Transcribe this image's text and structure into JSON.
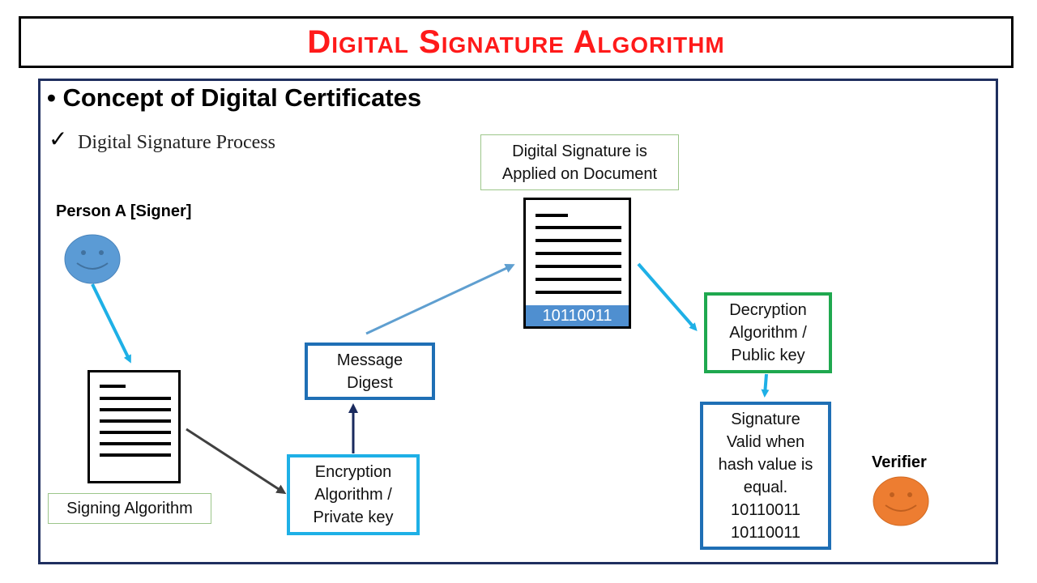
{
  "title": "Digital Signature Algorithm",
  "heading": "Concept of Digital Certificates",
  "bullet_char": "•",
  "check_char": "✓",
  "subheading": "Digital Signature Process",
  "person_a": "Person A [Signer]",
  "verifier": "Verifier",
  "signing_algorithm": "Signing Algorithm",
  "encryption": [
    "Encryption",
    "Algorithm /",
    "Private key"
  ],
  "message_digest": [
    "Message",
    "Digest"
  ],
  "applied": [
    "Digital Signature is",
    "Applied on Document"
  ],
  "signature_bits": "10110011",
  "decryption": [
    "Decryption",
    "Algorithm /",
    "Public key"
  ],
  "valid": [
    "Signature",
    "Valid when",
    "hash value is",
    "equal.",
    "10110011",
    "10110011"
  ],
  "colors": {
    "title_red": "#ff1a1a",
    "signer_face": "#5b9bd5",
    "verifier_face": "#ed7d31",
    "cyan_border": "#1eb0e6",
    "blue_border": "#1f6fb5",
    "green_border": "#1fa84f",
    "light_green_border": "#9cc68a"
  }
}
